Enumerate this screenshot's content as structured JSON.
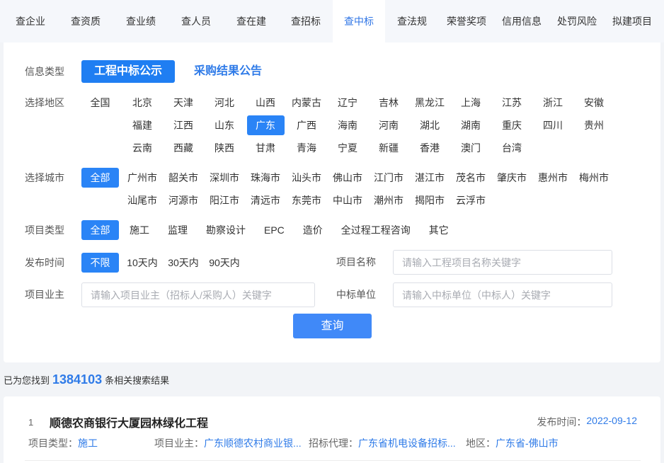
{
  "nav": {
    "items": [
      "查企业",
      "查资质",
      "查业绩",
      "查人员",
      "查在建",
      "查招标",
      "查中标",
      "查法规",
      "荣誉奖项",
      "信用信息",
      "处罚风险",
      "拟建项目"
    ],
    "active_index": 6
  },
  "filters": {
    "info_type": {
      "label": "信息类型",
      "options": [
        "工程中标公示",
        "采购结果公告"
      ],
      "selected_index": 0
    },
    "region": {
      "label": "选择地区",
      "all": "全国",
      "provinces": [
        "北京",
        "天津",
        "河北",
        "山西",
        "内蒙古",
        "辽宁",
        "吉林",
        "黑龙江",
        "上海",
        "江苏",
        "浙江",
        "安徽",
        "福建",
        "江西",
        "山东",
        "广东",
        "广西",
        "海南",
        "河南",
        "湖北",
        "湖南",
        "重庆",
        "四川",
        "贵州",
        "云南",
        "西藏",
        "陕西",
        "甘肃",
        "青海",
        "宁夏",
        "新疆",
        "香港",
        "澳门",
        "台湾"
      ],
      "selected_index": 15
    },
    "city": {
      "label": "选择城市",
      "all": "全部",
      "cities": [
        "广州市",
        "韶关市",
        "深圳市",
        "珠海市",
        "汕头市",
        "佛山市",
        "江门市",
        "湛江市",
        "茂名市",
        "肇庆市",
        "惠州市",
        "梅州市",
        "汕尾市",
        "河源市",
        "阳江市",
        "清远市",
        "东莞市",
        "中山市",
        "潮州市",
        "揭阳市",
        "云浮市"
      ],
      "selected_index": -1
    },
    "project_type": {
      "label": "项目类型",
      "all": "全部",
      "types": [
        "施工",
        "监理",
        "勘察设计",
        "EPC",
        "造价",
        "全过程工程咨询",
        "其它"
      ],
      "selected_index": -1
    },
    "publish_time": {
      "label": "发布时间",
      "all": "不限",
      "options": [
        "10天内",
        "30天内",
        "90天内"
      ],
      "selected_index": -1
    },
    "project_name": {
      "label": "项目名称",
      "placeholder": "请输入工程项目名称关键字"
    },
    "project_owner": {
      "label": "项目业主",
      "placeholder": "请输入项目业主（招标人/采购人）关键字"
    },
    "winning_unit": {
      "label": "中标单位",
      "placeholder": "请输入中标单位（中标人）关键字"
    },
    "search_label": "查询"
  },
  "summary": {
    "prefix": "已为您找到",
    "count": "1384103",
    "suffix": "条相关搜索结果"
  },
  "results": [
    {
      "index": "1",
      "title": "顺德农商银行大厦园林绿化工程",
      "publish_label": "发布时间：",
      "publish_date": "2022-09-12",
      "meta": [
        {
          "label": "项目类型：",
          "value": "施工"
        },
        {
          "label": "项目业主：",
          "value": "广东顺德农村商业银..."
        },
        {
          "label": "招标代理：",
          "value": "广东省机电设备招标..."
        },
        {
          "label": "地区：",
          "value": "广东省-佛山市"
        }
      ]
    }
  ],
  "colors": {
    "primary": "#1f7ef2",
    "accent": "#2a84f6",
    "link": "#2f7be8",
    "button": "#4089f8",
    "nav_active": "#2f75e6",
    "nav_bg": "#f5f7fb",
    "page_bg": "#f2f4f7"
  }
}
